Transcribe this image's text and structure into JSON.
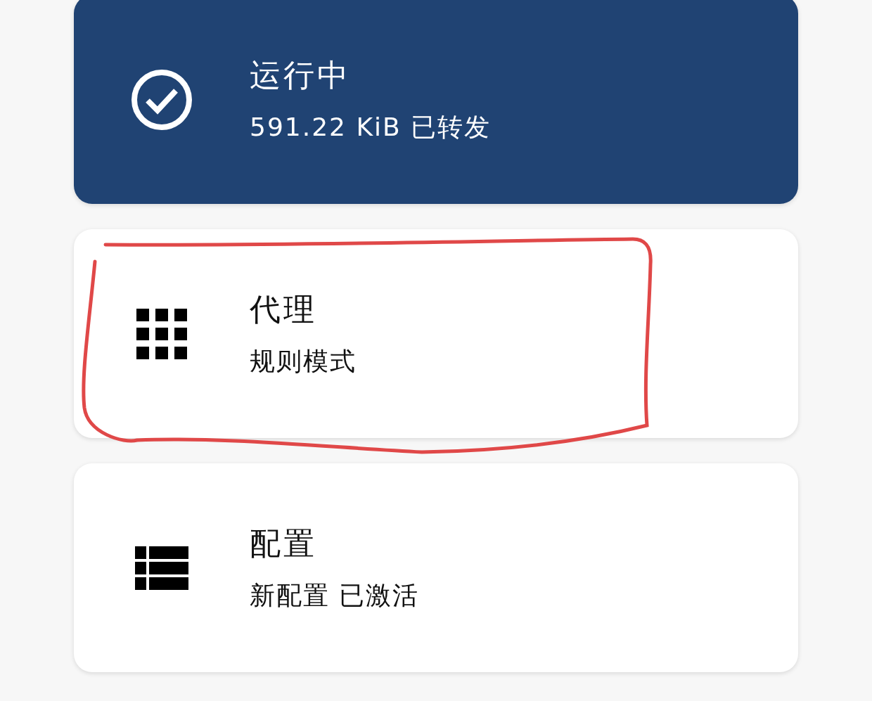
{
  "cards": [
    {
      "kind": "status",
      "title": "运行中",
      "subtitle": "591.22 KiB 已转发",
      "highlighted": false
    },
    {
      "kind": "plain",
      "title": "代理",
      "subtitle": "规则模式",
      "highlighted": true
    },
    {
      "kind": "plain",
      "title": "配置",
      "subtitle": "新配置 已激活",
      "highlighted": false
    }
  ]
}
